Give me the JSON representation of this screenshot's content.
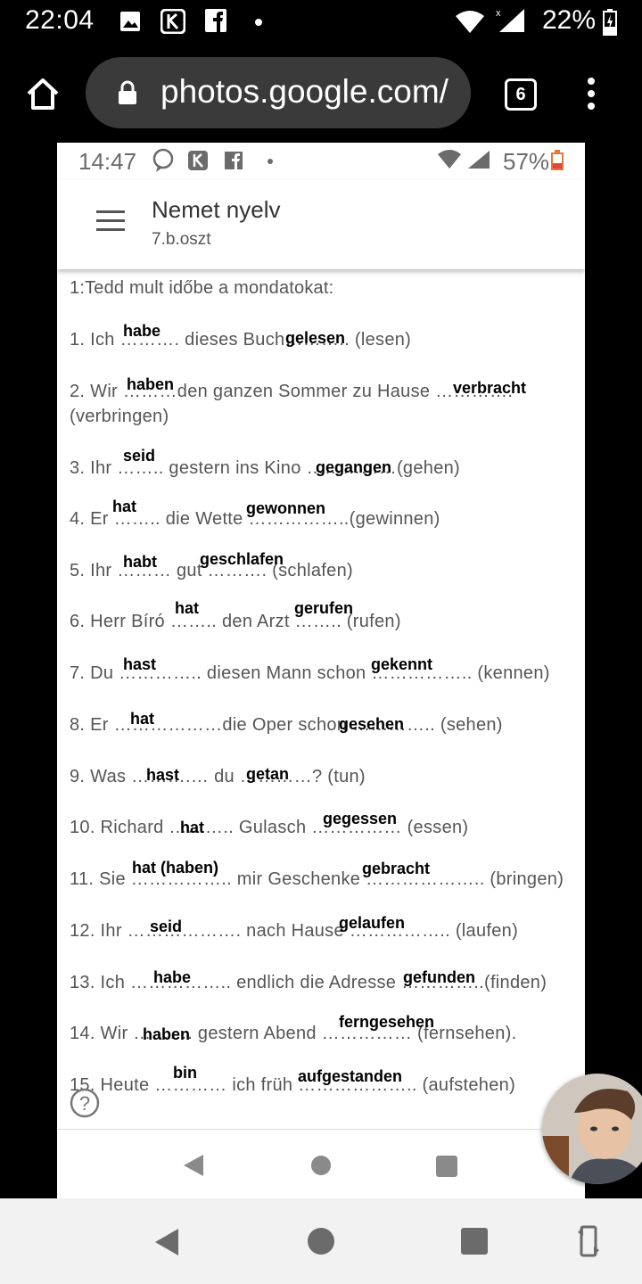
{
  "outer_status": {
    "time": "22:04",
    "battery": "22%"
  },
  "browser": {
    "url": "photos.google.com/",
    "tab_count": "6"
  },
  "photo": {
    "status": {
      "time": "14:47",
      "battery": "57%"
    },
    "header": {
      "title": "Nemet nyelv",
      "subtitle": "7.b.oszt"
    },
    "intro": "1:Tedd mult időbe a mondatokat:",
    "lines": [
      {
        "text": "1. Ich ………. dieses Buch……….. (lesen)",
        "answers": [
          "habe",
          "gelesen"
        ]
      },
      {
        "text": "2. Wir ………den ganzen Sommer zu Hause ………….",
        "text2": "(verbringen)",
        "answers": [
          "haben",
          "verbracht"
        ]
      },
      {
        "text": "3. Ihr …….. gestern ins Kino ……………(gehen)",
        "answers": [
          "seid",
          "gegangen"
        ]
      },
      {
        "text": "4. Er …….. die Wette ……………..(gewinnen)",
        "answers": [
          "hat",
          "gewonnen"
        ]
      },
      {
        "text": "5. Ihr ……… gut ………. (schlafen)",
        "answers": [
          "habt",
          "geschlafen"
        ]
      },
      {
        "text": "6. Herr Bíró …….. den Arzt …….. (rufen)",
        "answers": [
          "hat",
          "gerufen"
        ]
      },
      {
        "text": "7. Du ………….. diesen Mann schon …………….. (kennen)",
        "answers": [
          "hast",
          "gekennt"
        ]
      },
      {
        "text": "8. Er ………………die Oper schon ………….. (sehen)",
        "answers": [
          "hat",
          "gesehen"
        ]
      },
      {
        "text": "9. Was ……….… du …………? (tun)",
        "answers": [
          "hast",
          "getan"
        ]
      },
      {
        "text": "10. Richard ……….. Gulasch …………… (essen)",
        "answers": [
          "hat",
          "gegessen"
        ]
      },
      {
        "text": "11. Sie …………….. mir Geschenke ……………….. (bringen)",
        "answers": [
          "hat (haben)",
          "gebracht"
        ]
      },
      {
        "text": "12. Ihr ………………. nach Hause …………….. (laufen)",
        "answers": [
          "seid",
          "gelaufen"
        ]
      },
      {
        "text": "13. Ich …………….. endlich die Adresse …………..(finden)",
        "answers": [
          "habe",
          "gefunden"
        ]
      },
      {
        "text": "14. Wir ………. gestern Abend …………… (fernsehen).",
        "answers": [
          "haben",
          "ferngesehen"
        ]
      },
      {
        "text": "15. Heute ………… ich früh ……………….. (aufstehen)",
        "answers": [
          "bin",
          "aufgestanden"
        ]
      }
    ]
  }
}
